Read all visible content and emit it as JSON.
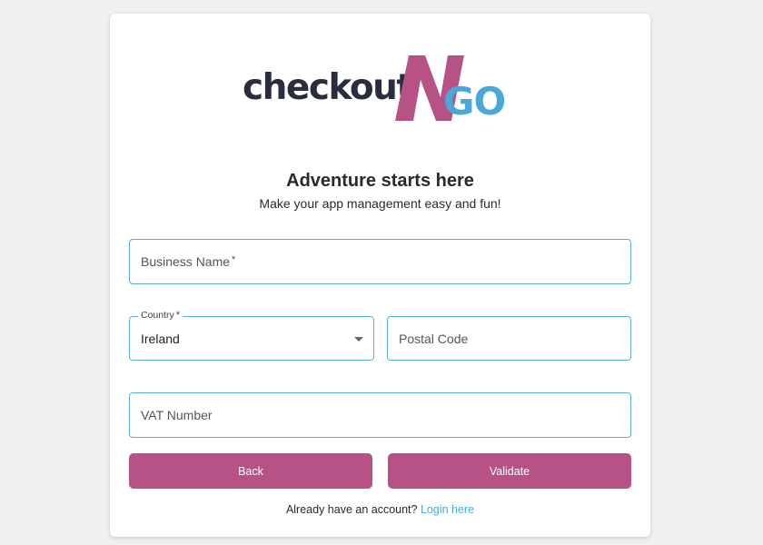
{
  "brand": {
    "logo_word": "checkout",
    "logo_n": "N",
    "logo_go": "GO",
    "colors": {
      "dark": "#2a2d3f",
      "magenta": "#b75286",
      "blue": "#4aa8d8"
    }
  },
  "header": {
    "title": "Adventure starts here",
    "subtitle": "Make your app management easy and fun!"
  },
  "form": {
    "business_name": {
      "placeholder": "Business Name",
      "required_mark": "*"
    },
    "country": {
      "label": "Country",
      "required_mark": "*",
      "value": "Ireland"
    },
    "postal_code": {
      "placeholder": "Postal Code"
    },
    "vat_number": {
      "placeholder": "VAT Number"
    }
  },
  "actions": {
    "back_label": "Back",
    "validate_label": "Validate"
  },
  "footer": {
    "prompt": "Already have an account?",
    "login_link": "Login here"
  }
}
